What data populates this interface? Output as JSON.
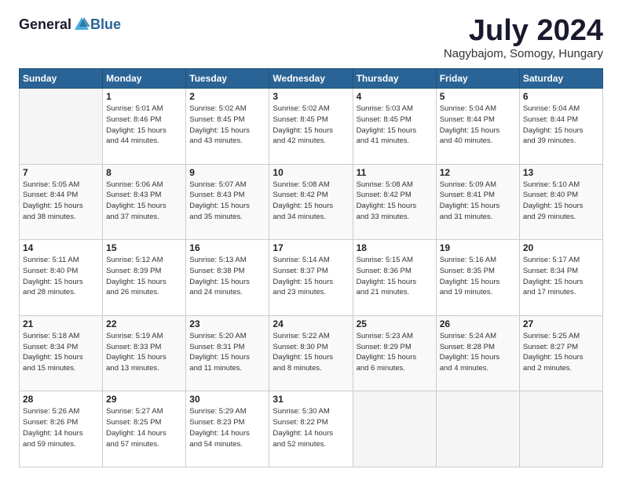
{
  "logo": {
    "general": "General",
    "blue": "Blue"
  },
  "title": "July 2024",
  "location": "Nagybajom, Somogy, Hungary",
  "days_header": [
    "Sunday",
    "Monday",
    "Tuesday",
    "Wednesday",
    "Thursday",
    "Friday",
    "Saturday"
  ],
  "weeks": [
    [
      {
        "day": "",
        "info": ""
      },
      {
        "day": "1",
        "info": "Sunrise: 5:01 AM\nSunset: 8:46 PM\nDaylight: 15 hours\nand 44 minutes."
      },
      {
        "day": "2",
        "info": "Sunrise: 5:02 AM\nSunset: 8:45 PM\nDaylight: 15 hours\nand 43 minutes."
      },
      {
        "day": "3",
        "info": "Sunrise: 5:02 AM\nSunset: 8:45 PM\nDaylight: 15 hours\nand 42 minutes."
      },
      {
        "day": "4",
        "info": "Sunrise: 5:03 AM\nSunset: 8:45 PM\nDaylight: 15 hours\nand 41 minutes."
      },
      {
        "day": "5",
        "info": "Sunrise: 5:04 AM\nSunset: 8:44 PM\nDaylight: 15 hours\nand 40 minutes."
      },
      {
        "day": "6",
        "info": "Sunrise: 5:04 AM\nSunset: 8:44 PM\nDaylight: 15 hours\nand 39 minutes."
      }
    ],
    [
      {
        "day": "7",
        "info": "Sunrise: 5:05 AM\nSunset: 8:44 PM\nDaylight: 15 hours\nand 38 minutes."
      },
      {
        "day": "8",
        "info": "Sunrise: 5:06 AM\nSunset: 8:43 PM\nDaylight: 15 hours\nand 37 minutes."
      },
      {
        "day": "9",
        "info": "Sunrise: 5:07 AM\nSunset: 8:43 PM\nDaylight: 15 hours\nand 35 minutes."
      },
      {
        "day": "10",
        "info": "Sunrise: 5:08 AM\nSunset: 8:42 PM\nDaylight: 15 hours\nand 34 minutes."
      },
      {
        "day": "11",
        "info": "Sunrise: 5:08 AM\nSunset: 8:42 PM\nDaylight: 15 hours\nand 33 minutes."
      },
      {
        "day": "12",
        "info": "Sunrise: 5:09 AM\nSunset: 8:41 PM\nDaylight: 15 hours\nand 31 minutes."
      },
      {
        "day": "13",
        "info": "Sunrise: 5:10 AM\nSunset: 8:40 PM\nDaylight: 15 hours\nand 29 minutes."
      }
    ],
    [
      {
        "day": "14",
        "info": "Sunrise: 5:11 AM\nSunset: 8:40 PM\nDaylight: 15 hours\nand 28 minutes."
      },
      {
        "day": "15",
        "info": "Sunrise: 5:12 AM\nSunset: 8:39 PM\nDaylight: 15 hours\nand 26 minutes."
      },
      {
        "day": "16",
        "info": "Sunrise: 5:13 AM\nSunset: 8:38 PM\nDaylight: 15 hours\nand 24 minutes."
      },
      {
        "day": "17",
        "info": "Sunrise: 5:14 AM\nSunset: 8:37 PM\nDaylight: 15 hours\nand 23 minutes."
      },
      {
        "day": "18",
        "info": "Sunrise: 5:15 AM\nSunset: 8:36 PM\nDaylight: 15 hours\nand 21 minutes."
      },
      {
        "day": "19",
        "info": "Sunrise: 5:16 AM\nSunset: 8:35 PM\nDaylight: 15 hours\nand 19 minutes."
      },
      {
        "day": "20",
        "info": "Sunrise: 5:17 AM\nSunset: 8:34 PM\nDaylight: 15 hours\nand 17 minutes."
      }
    ],
    [
      {
        "day": "21",
        "info": "Sunrise: 5:18 AM\nSunset: 8:34 PM\nDaylight: 15 hours\nand 15 minutes."
      },
      {
        "day": "22",
        "info": "Sunrise: 5:19 AM\nSunset: 8:33 PM\nDaylight: 15 hours\nand 13 minutes."
      },
      {
        "day": "23",
        "info": "Sunrise: 5:20 AM\nSunset: 8:31 PM\nDaylight: 15 hours\nand 11 minutes."
      },
      {
        "day": "24",
        "info": "Sunrise: 5:22 AM\nSunset: 8:30 PM\nDaylight: 15 hours\nand 8 minutes."
      },
      {
        "day": "25",
        "info": "Sunrise: 5:23 AM\nSunset: 8:29 PM\nDaylight: 15 hours\nand 6 minutes."
      },
      {
        "day": "26",
        "info": "Sunrise: 5:24 AM\nSunset: 8:28 PM\nDaylight: 15 hours\nand 4 minutes."
      },
      {
        "day": "27",
        "info": "Sunrise: 5:25 AM\nSunset: 8:27 PM\nDaylight: 15 hours\nand 2 minutes."
      }
    ],
    [
      {
        "day": "28",
        "info": "Sunrise: 5:26 AM\nSunset: 8:26 PM\nDaylight: 14 hours\nand 59 minutes."
      },
      {
        "day": "29",
        "info": "Sunrise: 5:27 AM\nSunset: 8:25 PM\nDaylight: 14 hours\nand 57 minutes."
      },
      {
        "day": "30",
        "info": "Sunrise: 5:29 AM\nSunset: 8:23 PM\nDaylight: 14 hours\nand 54 minutes."
      },
      {
        "day": "31",
        "info": "Sunrise: 5:30 AM\nSunset: 8:22 PM\nDaylight: 14 hours\nand 52 minutes."
      },
      {
        "day": "",
        "info": ""
      },
      {
        "day": "",
        "info": ""
      },
      {
        "day": "",
        "info": ""
      }
    ]
  ]
}
